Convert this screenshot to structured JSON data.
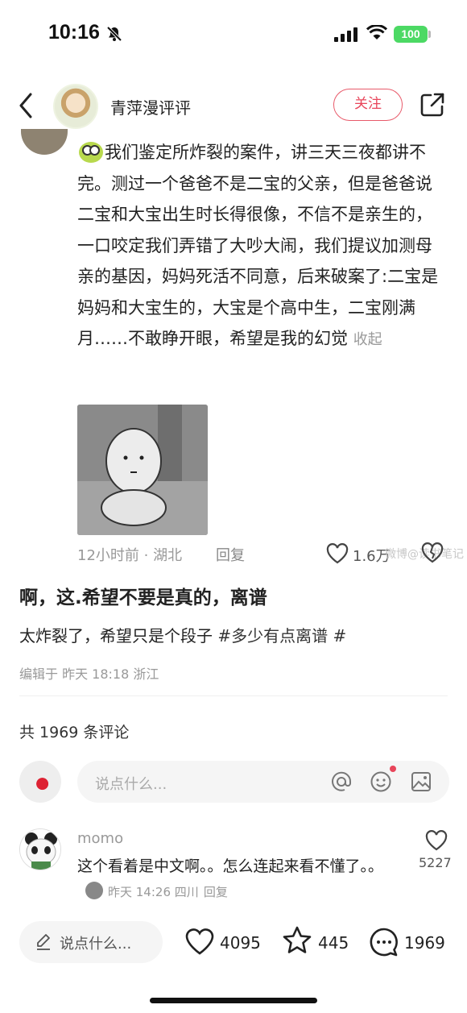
{
  "status_bar": {
    "time": "10:16",
    "battery": "100"
  },
  "header": {
    "author_name": "青萍漫评评",
    "follow_label": "关注"
  },
  "comment": {
    "text": "我们鉴定所炸裂的案件，讲三天三夜都讲不完。测过一个爸爸不是二宝的父亲，但是爸爸说二宝和大宝出生时长得很像，不信不是亲生的，一口咬定我们弄错了大吵大闹，我们提议加测母亲的基因，妈妈死活不同意，后来破案了:二宝是妈妈和大宝生的，大宝是个高中生，二宝刚满月……不敢睁开眼，希望是我的幻觉",
    "collapse_label": "收起",
    "meta": "12小时前 · 湖北",
    "reply_label": "回复",
    "like_count": "1.6万",
    "watermark": "微博@读书笔记"
  },
  "post": {
    "title": "啊，这.希望不要是真的，离谱",
    "desc": "太炸裂了，希望只是个段子",
    "tag": "#多少有点离谱 #",
    "edited": "编辑于 昨天 18:18 浙江"
  },
  "comments_section": {
    "count_label": "共 1969 条评论",
    "input_placeholder": "说点什么..."
  },
  "top_comment": {
    "user": "momo",
    "text": "这个看着是中文啊。。怎么连起来看不懂了。。",
    "meta": "昨天 14:26 四川",
    "reply_label": "回复",
    "like_count": "5227"
  },
  "bottom_bar": {
    "input_label": "说点什么...",
    "like_count": "4095",
    "star_count": "445",
    "comment_count": "1969"
  },
  "colors": {
    "accent": "#e8455a",
    "battery": "#4cd964"
  },
  "icons": [
    "bell-off-icon",
    "signal-icon",
    "wifi-icon",
    "back-icon",
    "share-icon",
    "heart-icon",
    "at-icon",
    "emoji-icon",
    "image-icon",
    "pencil-icon",
    "star-icon",
    "chat-icon"
  ]
}
